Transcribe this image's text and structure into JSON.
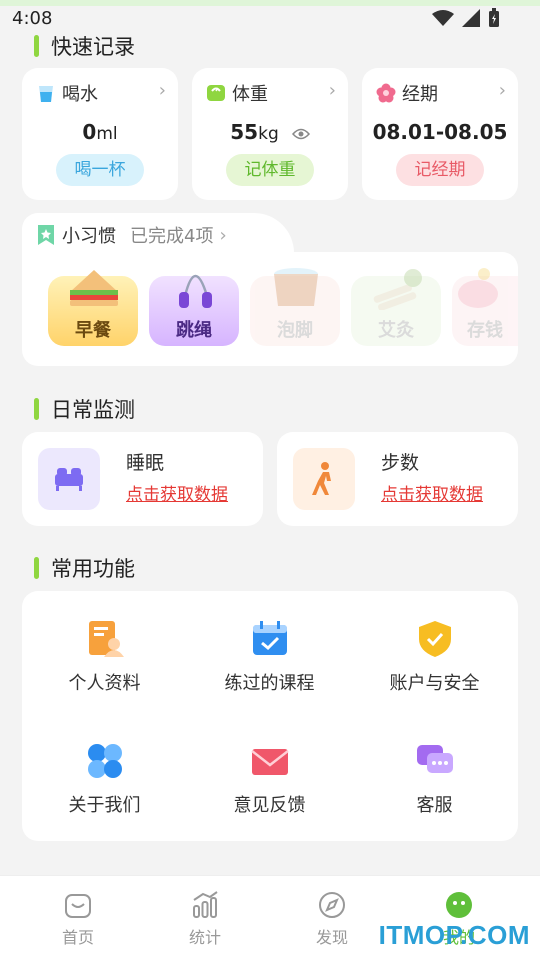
{
  "status": {
    "time": "4:08"
  },
  "quick_record": {
    "title": "快速记录",
    "cards": [
      {
        "label": "喝水",
        "value": "0",
        "unit": "ml",
        "button": "喝一杯"
      },
      {
        "label": "体重",
        "value": "55",
        "unit": "kg",
        "button": "记体重"
      },
      {
        "label": "经期",
        "value": "08.01-08.05",
        "unit": "",
        "button": "记经期"
      }
    ]
  },
  "habits": {
    "title": "小习惯",
    "subtitle": "已完成4项",
    "items": [
      {
        "label": "早餐",
        "icon": "sandwich-icon"
      },
      {
        "label": "跳绳",
        "icon": "jump-rope-icon"
      },
      {
        "label": "泡脚",
        "icon": "foot-bath-icon"
      },
      {
        "label": "艾灸",
        "icon": "moxibustion-icon"
      },
      {
        "label": "存钱",
        "icon": "piggy-bank-icon"
      }
    ]
  },
  "daily_monitor": {
    "title": "日常监测",
    "items": [
      {
        "label": "睡眠",
        "link": "点击获取数据",
        "icon": "bed-icon"
      },
      {
        "label": "步数",
        "link": "点击获取数据",
        "icon": "walking-icon"
      }
    ]
  },
  "functions": {
    "title": "常用功能",
    "items": [
      {
        "label": "个人资料",
        "icon": "profile-icon"
      },
      {
        "label": "练过的课程",
        "icon": "calendar-check-icon"
      },
      {
        "label": "账户与安全",
        "icon": "shield-icon"
      },
      {
        "label": "关于我们",
        "icon": "clover-icon"
      },
      {
        "label": "意见反馈",
        "icon": "mail-icon"
      },
      {
        "label": "客服",
        "icon": "chat-icon"
      }
    ]
  },
  "nav": {
    "items": [
      {
        "label": "首页",
        "icon": "home-icon"
      },
      {
        "label": "统计",
        "icon": "stats-icon"
      },
      {
        "label": "发现",
        "icon": "compass-icon"
      },
      {
        "label": "我的",
        "icon": "me-icon",
        "active": true
      }
    ]
  },
  "watermark": "ITMOP.COM",
  "colors": {
    "accent": "#8fd640",
    "link": "#e53935",
    "nav_active": "#5fbf3a"
  }
}
